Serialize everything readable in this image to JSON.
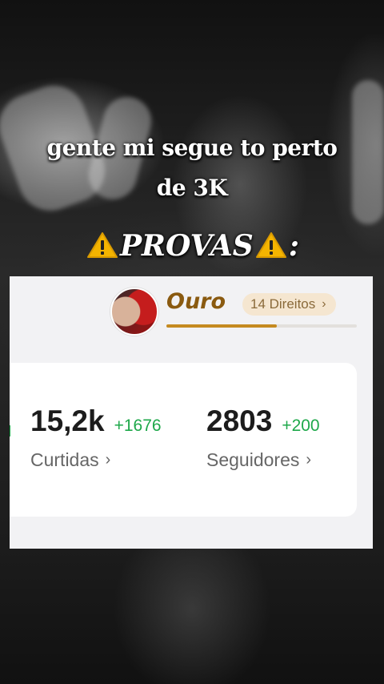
{
  "caption": {
    "line1": "gente mi segue to perto",
    "line2": "de 3K",
    "provas": "PROVAS",
    "suffix": ":"
  },
  "profile": {
    "tier": "Ouro",
    "rights_label": "14 Direitos",
    "rights_chevron": "›",
    "progress_fraction": 0.58
  },
  "stats": {
    "likes": {
      "value": "15,2k",
      "delta": "+1676",
      "label": "Curtidas",
      "chevron": "›"
    },
    "followers": {
      "value": "2803",
      "delta": "+200",
      "label": "Seguidores",
      "chevron": "›"
    }
  },
  "colors": {
    "gold": "#8a5a10",
    "delta_green": "#1ea84a",
    "warning_yellow": "#f4b400"
  },
  "icons": [
    "warning-icon",
    "chevron-right-icon"
  ]
}
